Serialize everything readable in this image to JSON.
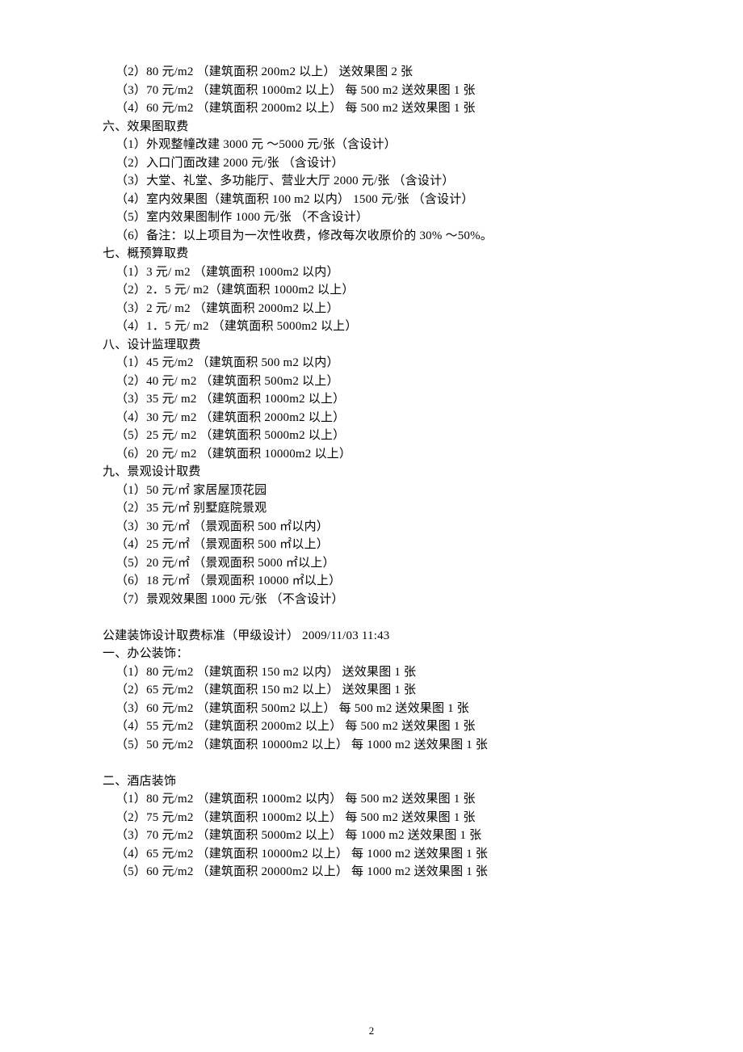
{
  "lines": [
    {
      "cls": "indent1",
      "t": "（2）80 元/m2 （建筑面积 200m2 以上） 送效果图 2 张"
    },
    {
      "cls": "indent1",
      "t": "（3）70 元/m2 （建筑面积 1000m2 以上） 每 500 m2 送效果图 1 张"
    },
    {
      "cls": "indent1",
      "t": "（4）60 元/m2 （建筑面积 2000m2 以上） 每 500 m2 送效果图 1 张"
    },
    {
      "cls": "",
      "t": "六、效果图取费"
    },
    {
      "cls": "indent1",
      "t": "（1）外观整幢改建 3000 元 ～5000 元/张（含设计）"
    },
    {
      "cls": "indent1",
      "t": "（2）入口门面改建 2000 元/张 （含设计）"
    },
    {
      "cls": "indent1",
      "t": "（3）大堂、礼堂、多功能厅、营业大厅 2000 元/张 （含设计）"
    },
    {
      "cls": "indent1",
      "t": "（4）室内效果图（建筑面积 100 m2 以内） 1500 元/张 （含设计）"
    },
    {
      "cls": "indent1",
      "t": "（5）室内效果图制作 1000 元/张 （不含设计）"
    },
    {
      "cls": "indent1",
      "t": "（6）备注：以上项目为一次性收费，修改每次收原价的 30% ～50%。"
    },
    {
      "cls": "",
      "t": "七、概预算取费"
    },
    {
      "cls": "indent1",
      "t": "（1）3 元/ m2 （建筑面积 1000m2 以内）"
    },
    {
      "cls": "indent1",
      "t": "（2）2．5 元/ m2（建筑面积 1000m2 以上）"
    },
    {
      "cls": "indent1",
      "t": "（3）2 元/ m2 （建筑面积 2000m2 以上）"
    },
    {
      "cls": "indent1",
      "t": "（4）1．5 元/ m2 （建筑面积 5000m2 以上）"
    },
    {
      "cls": "",
      "t": "八、设计监理取费"
    },
    {
      "cls": "indent1",
      "t": "（1）45 元/m2 （建筑面积 500 m2 以内）"
    },
    {
      "cls": "indent1",
      "t": "（2）40 元/ m2 （建筑面积 500m2 以上）"
    },
    {
      "cls": "indent1",
      "t": "（3）35 元/ m2 （建筑面积 1000m2 以上）"
    },
    {
      "cls": "indent1",
      "t": "（4）30 元/ m2 （建筑面积 2000m2 以上）"
    },
    {
      "cls": "indent1",
      "t": "（5）25 元/ m2 （建筑面积 5000m2 以上）"
    },
    {
      "cls": "indent1",
      "t": "（6）20 元/ m2 （建筑面积 10000m2 以上）"
    },
    {
      "cls": "",
      "t": "九、景观设计取费"
    },
    {
      "cls": "indent1",
      "t": "（1）50 元/㎡ 家居屋顶花园"
    },
    {
      "cls": "indent1",
      "t": "（2）35 元/㎡ 别墅庭院景观"
    },
    {
      "cls": "indent1",
      "t": "（3）30 元/㎡ （景观面积 500 ㎡以内）"
    },
    {
      "cls": "indent1",
      "t": "（4）25 元/㎡ （景观面积 500 ㎡以上）"
    },
    {
      "cls": "indent1",
      "t": "（5）20 元/㎡ （景观面积 5000 ㎡以上）"
    },
    {
      "cls": "indent1",
      "t": "（6）18 元/㎡ （景观面积 10000 ㎡以上）"
    },
    {
      "cls": "indent1",
      "t": "（7）景观效果图 1000 元/张 （不含设计）"
    },
    {
      "cls": "blank",
      "t": ""
    },
    {
      "cls": "",
      "t": "公建装饰设计取费标准（甲级设计） 2009/11/03 11:43"
    },
    {
      "cls": "",
      "t": "一、办公装饰："
    },
    {
      "cls": "indent1",
      "t": "（1）80 元/m2 （建筑面积 150 m2 以内） 送效果图 1 张"
    },
    {
      "cls": "indent1",
      "t": "（2）65 元/m2 （建筑面积 150 m2 以上） 送效果图 1 张"
    },
    {
      "cls": "indent1",
      "t": "（3）60 元/m2 （建筑面积 500m2 以上） 每 500 m2 送效果图 1 张"
    },
    {
      "cls": "indent1",
      "t": "（4）55 元/m2 （建筑面积 2000m2 以上） 每 500 m2 送效果图 1 张"
    },
    {
      "cls": "indent1",
      "t": "（5）50 元/m2 （建筑面积 10000m2 以上） 每 1000 m2 送效果图 1 张"
    },
    {
      "cls": "blank",
      "t": ""
    },
    {
      "cls": "",
      "t": "二、酒店装饰"
    },
    {
      "cls": "indent1",
      "t": "（1）80 元/m2 （建筑面积 1000m2 以内） 每 500 m2 送效果图 1 张"
    },
    {
      "cls": "indent1",
      "t": "（2）75 元/m2 （建筑面积 1000m2 以上） 每 500 m2 送效果图 1 张"
    },
    {
      "cls": "indent1",
      "t": "（3）70 元/m2 （建筑面积 5000m2 以上） 每 1000 m2 送效果图 1 张"
    },
    {
      "cls": "indent1",
      "t": "（4）65 元/m2 （建筑面积 10000m2 以上） 每 1000 m2 送效果图 1 张"
    },
    {
      "cls": "indent1",
      "t": "（5）60 元/m2 （建筑面积 20000m2 以上） 每 1000 m2 送效果图 1 张"
    }
  ],
  "page_number": "2"
}
